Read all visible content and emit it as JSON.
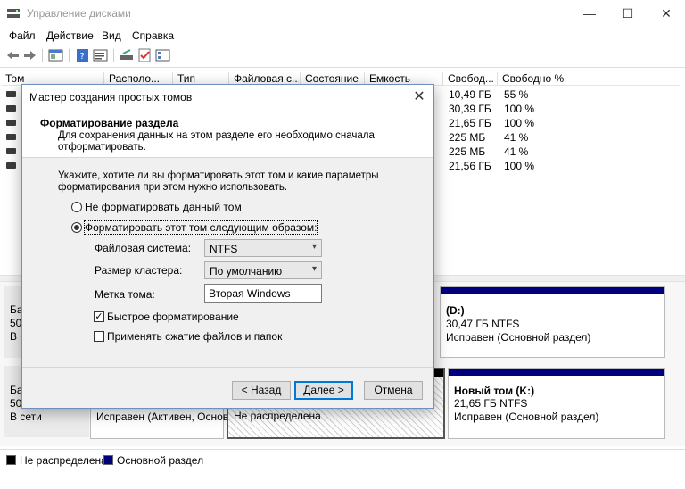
{
  "window": {
    "title": "Управление дисками",
    "minimize": "—",
    "maximize": "☐",
    "close": "✕"
  },
  "menu": [
    "Файл",
    "Действие",
    "Вид",
    "Справка"
  ],
  "volume_list": {
    "columns": [
      "Том",
      "Располо...",
      "Тип",
      "Файловая с...",
      "Состояние",
      "Емкость",
      "Свобод...",
      "Свободно %"
    ],
    "rows": [
      {
        "free": "10,49 ГБ",
        "pct": "55 %"
      },
      {
        "free": "30,39 ГБ",
        "pct": "100 %"
      },
      {
        "free": "21,65 ГБ",
        "pct": "100 %"
      },
      {
        "free": "225 МБ",
        "pct": "41 %"
      },
      {
        "free": "225 МБ",
        "pct": "41 %"
      },
      {
        "free": "21,56 ГБ",
        "pct": "100 %"
      }
    ]
  },
  "disk_map": {
    "disk0": {
      "line1": "Ба",
      "line2": "50,",
      "line3": "В с"
    },
    "disk1": {
      "line1": "Ба",
      "line2": "50,",
      "line3": "В сети"
    },
    "partitions": {
      "d": {
        "name": "(D:)",
        "size": "30,47 ГБ NTFS",
        "status": "Исправен (Основной раздел)"
      },
      "active": {
        "status": "Исправен (Активен, Основ"
      },
      "unalloc": {
        "status": "Не распределена"
      },
      "k": {
        "name": "Новый том  (K:)",
        "size": "21,65 ГБ NTFS",
        "status": "Исправен (Основной раздел)"
      }
    }
  },
  "legend": {
    "unallocated": "Не распределена",
    "primary": "Основной раздел",
    "colors": {
      "unallocated": "#000000",
      "primary": "#00007f"
    }
  },
  "dialog": {
    "title": "Мастер создания простых томов",
    "header_title": "Форматирование раздела",
    "header_desc": "Для сохранения данных на этом разделе его необходимо сначала отформатировать.",
    "intro": "Укажите, хотите ли вы форматировать этот том и какие параметры форматирования при этом нужно использовать.",
    "radio_no_format": "Не форматировать данный том",
    "radio_format": "Форматировать этот том следующим образом:",
    "fs_label": "Файловая система:",
    "fs_value": "NTFS",
    "cluster_label": "Размер кластера:",
    "cluster_value": "По умолчанию",
    "volume_label_label": "Метка тома:",
    "volume_label_value": "Вторая Windows",
    "quick_format": "Быстрое форматирование",
    "compression": "Применять сжатие файлов и папок",
    "back": "< Назад",
    "next": "Далее >",
    "cancel": "Отмена"
  }
}
